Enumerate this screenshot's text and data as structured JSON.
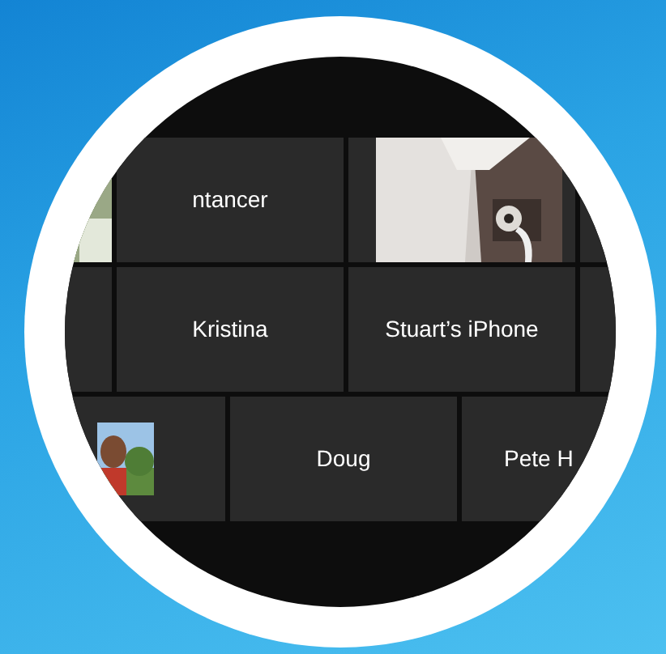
{
  "rows": [
    {
      "tiles": [
        {
          "kind": "picture"
        },
        {
          "kind": "name",
          "name": "ntancer"
        },
        {
          "kind": "picture"
        },
        {
          "kind": "blank"
        }
      ]
    },
    {
      "tiles": [
        {
          "kind": "blank"
        },
        {
          "kind": "name",
          "name": "Kristina"
        },
        {
          "kind": "name",
          "name": "Stuart’s iPhone"
        },
        {
          "kind": "blank"
        }
      ]
    },
    {
      "tiles": [
        {
          "kind": "picture"
        },
        {
          "kind": "name",
          "name": "Doug"
        },
        {
          "kind": "name",
          "name": "Pete H"
        }
      ]
    }
  ]
}
